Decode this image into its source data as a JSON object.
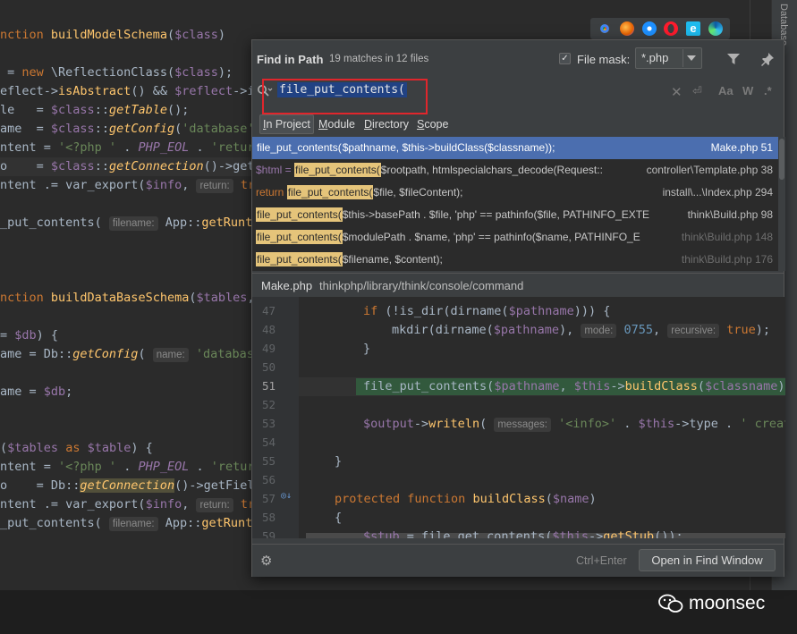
{
  "browser_bar": {
    "icons": [
      "chrome-icon",
      "firefox-icon",
      "safari-icon",
      "opera-icon",
      "ie-icon",
      "edge-icon"
    ]
  },
  "right_strip": {
    "text": "Database"
  },
  "background_code": {
    "lines": [
      "nction buildModelSchema($class)",
      "",
      " = new \\ReflectionClass($class);",
      "eflect->isAbstract() && $reflect->is",
      "le   = $class::getTable();",
      "ame  = $class::getConfig('database'",
      "ntent = '<?php ' . PHP_EOL . 'return",
      "o    = $class::getConnection()->getF",
      "ntent .= var_export($info,  return: tru",
      "",
      "_put_contents( filename: App::getRunti",
      "",
      "",
      "",
      "nction buildDataBaseSchema($tables,",
      "",
      "= $db) {",
      "ame = Db::getConfig( name: 'database'",
      "",
      "ame = $db;",
      "",
      "",
      "($tables as $table) {",
      "ntent = '<?php ' . PHP_EOL . 'return",
      "o    = Db::getConnection()->getField",
      "ntent .= var_export($info,  return: tru",
      "_put_contents( filename: App::getRunti"
    ]
  },
  "popup": {
    "title": "Find in Path",
    "match_count": "19 matches in 12 files",
    "file_mask_label": "File mask:",
    "file_mask_checked": "✓",
    "file_mask_value": "*.php",
    "search_value": "file_put_contents(",
    "search_options": [
      "Aa",
      "W",
      ".*"
    ],
    "scopes": [
      {
        "key": "I",
        "rest": "n Project",
        "active": true
      },
      {
        "key": "M",
        "rest": "odule",
        "active": false
      },
      {
        "key": "D",
        "rest": "irectory",
        "active": false
      },
      {
        "key": "S",
        "rest": "cope",
        "active": false
      }
    ],
    "results": [
      {
        "prefix": "",
        "match": "file_put_contents(",
        "rest": "$pathname, $this->buildClass($classname));",
        "location": "Make.php 51",
        "selected": true,
        "dim": false
      },
      {
        "prefix": "$html = ",
        "match": "file_put_contents(",
        "rest": "$rootpath, htmlspecialchars_decode(Request::",
        "location": "controller\\Template.php 38",
        "selected": false,
        "dim": false
      },
      {
        "prefix": "return ",
        "match": "file_put_contents(",
        "rest": "$file, $fileContent);",
        "location": "install\\...\\Index.php 294",
        "selected": false,
        "dim": false
      },
      {
        "prefix": "",
        "match": "file_put_contents(",
        "rest": "$this->basePath . $file, 'php' == pathinfo($file, PATHINFO_EXTE",
        "location": "think\\Build.php 98",
        "selected": false,
        "dim": false
      },
      {
        "prefix": "",
        "match": "file_put_contents(",
        "rest": "$modulePath . $name, 'php' == pathinfo($name, PATHINFO_E",
        "location": "think\\Build.php 148",
        "selected": false,
        "dim": true
      },
      {
        "prefix": "",
        "match": "file_put_contents(",
        "rest": "$filename, $content);",
        "location": "think\\Build.php 176",
        "selected": false,
        "dim": true
      }
    ],
    "preview_file": "Make.php",
    "preview_path": "thinkphp/library/think/console/command",
    "preview_line_numbers": [
      "47",
      "48",
      "49",
      "50",
      "51",
      "52",
      "53",
      "54",
      "55",
      "56",
      "57",
      "58",
      "59"
    ],
    "shortcut": "Ctrl+Enter",
    "open_button": "Open in Find Window"
  },
  "watermark": {
    "text": "moonsec"
  }
}
